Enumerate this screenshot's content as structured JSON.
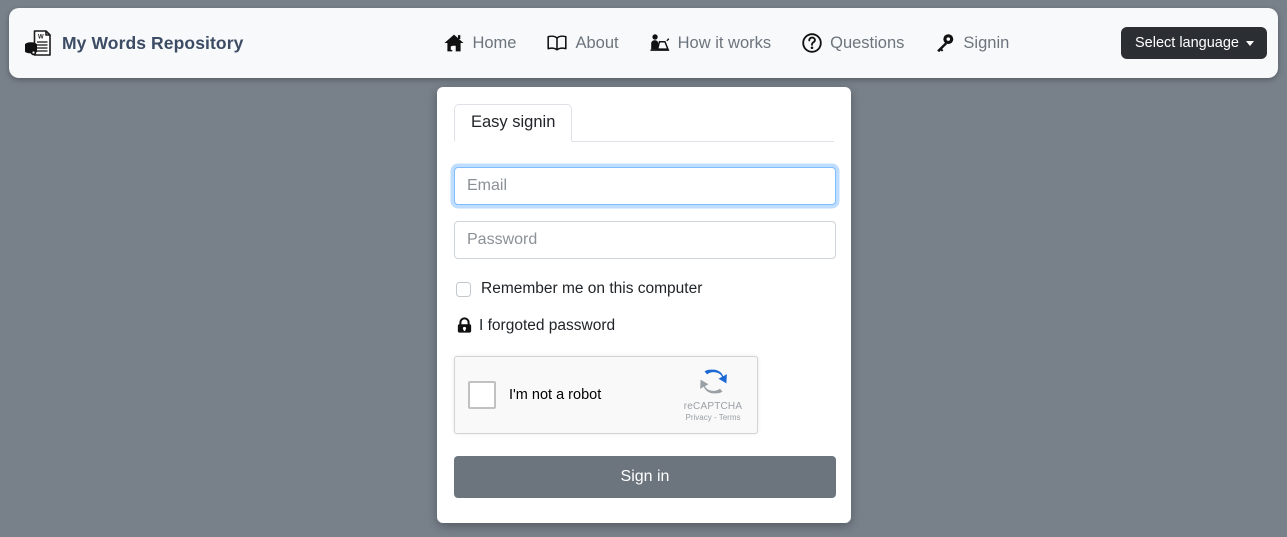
{
  "navbar": {
    "brand": {
      "text": "My Words Repository",
      "icon": "document-database-icon"
    },
    "links": [
      {
        "label": "Home",
        "icon": "home-icon"
      },
      {
        "label": "About",
        "icon": "open-book-icon"
      },
      {
        "label": "How it works",
        "icon": "person-at-laptop-icon"
      },
      {
        "label": "Questions",
        "icon": "question-circle-icon"
      },
      {
        "label": "Signin",
        "icon": "key-icon"
      }
    ],
    "language_button": {
      "label": "Select language",
      "icon": "caret-down-icon"
    }
  },
  "card": {
    "tabs": [
      {
        "label": "Easy signin",
        "active": true
      }
    ],
    "form": {
      "email": {
        "placeholder": "Email",
        "value": "",
        "focused": true
      },
      "password": {
        "placeholder": "Password",
        "value": ""
      },
      "remember": {
        "label": "Remember me on this computer",
        "checked": false
      },
      "forgot": {
        "label": "I forgoted password",
        "icon": "lock-icon"
      },
      "recaptcha": {
        "label": "I'm not a robot",
        "brand": "reCAPTCHA",
        "terms": "Privacy - Terms",
        "checked": false
      },
      "submit": {
        "label": "Sign in"
      }
    }
  },
  "colors": {
    "page_background": "#78808a",
    "navbar_background": "#f8f9fa",
    "brand_text": "#3c4c64",
    "nav_link": "#6c757d",
    "language_button": "#2b2f33",
    "submit_button": "#6c757d",
    "focus_ring": "#80bdff",
    "recaptcha_blue": "#1c69d4",
    "recaptcha_gray": "#9aa0a6"
  }
}
